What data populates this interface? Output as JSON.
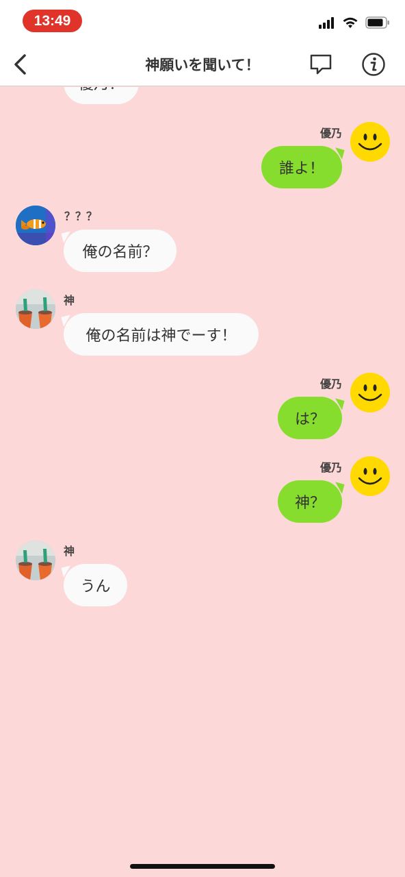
{
  "status": {
    "time": "13:49"
  },
  "header": {
    "title": "神願いを聞いて！"
  },
  "messages": [
    {
      "side": "left",
      "sender": "",
      "text": "優乃！"
    },
    {
      "side": "right",
      "sender": "優乃",
      "text": "誰よ！"
    },
    {
      "side": "left",
      "sender": "？？？",
      "text": "俺の名前？"
    },
    {
      "side": "left",
      "sender": "神",
      "text": "俺の名前は神でーす！"
    },
    {
      "side": "right",
      "sender": "優乃",
      "text": "は？"
    },
    {
      "side": "right",
      "sender": "優乃",
      "text": "神？"
    },
    {
      "side": "left",
      "sender": "神",
      "text": "うん"
    }
  ],
  "colors": {
    "background": "#fdd8d9",
    "right_bubble": "#86dd2e",
    "left_bubble": "#fafafa",
    "time_pill": "#e0342b"
  },
  "icons": [
    "back-icon",
    "chat-bubble-icon",
    "info-icon",
    "signal-icon",
    "wifi-icon",
    "battery-icon"
  ]
}
